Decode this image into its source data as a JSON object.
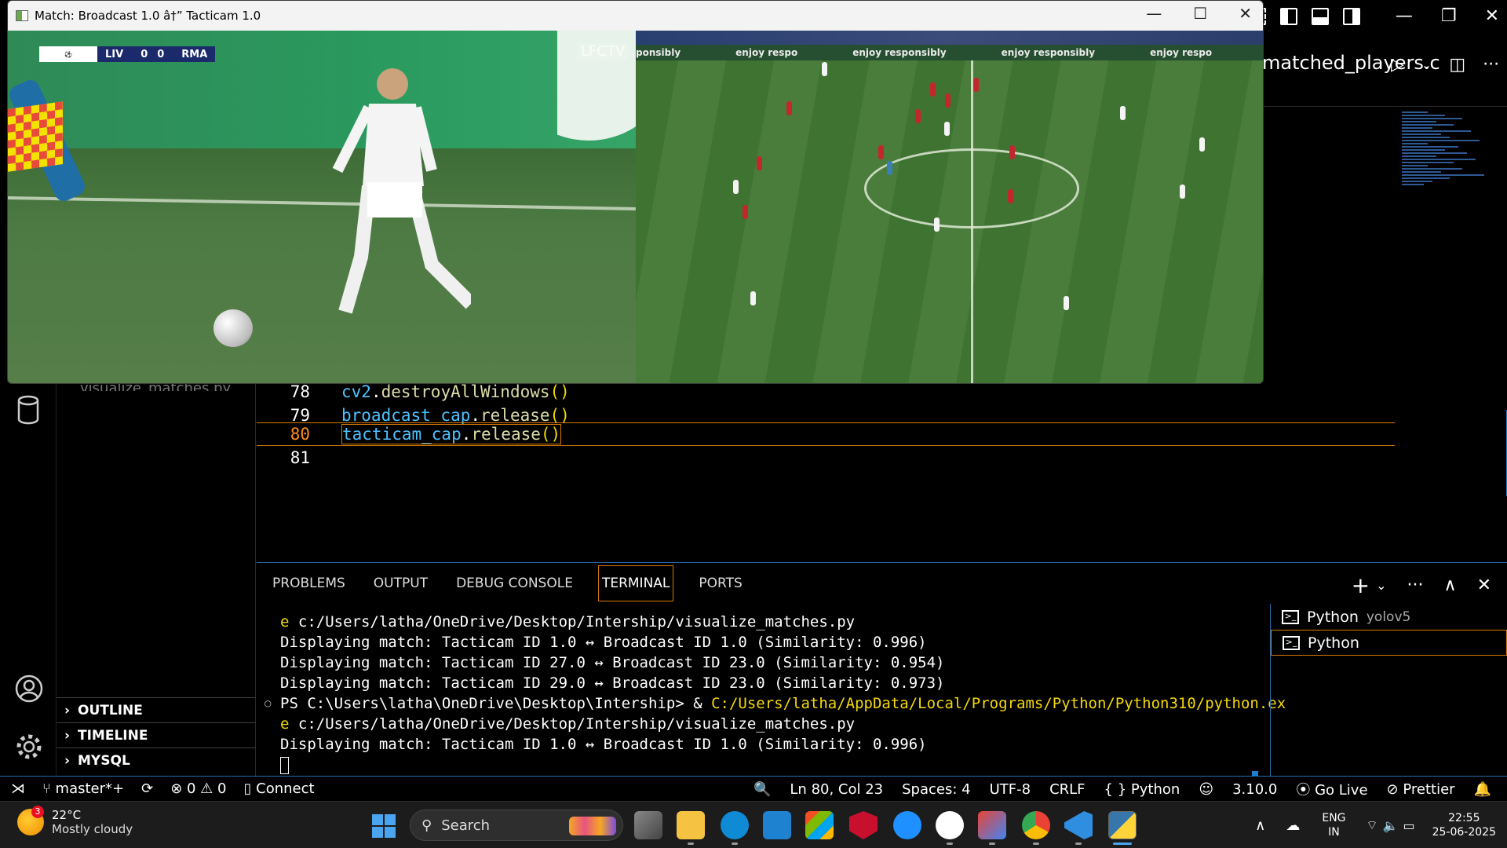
{
  "cv_window": {
    "title": "Match: Broadcast 1.0 â†” Tacticam 1.0",
    "minimize": "—",
    "maximize": "☐",
    "close": "✕",
    "broadcast": {
      "scoreboard": {
        "home": "LIV",
        "home_score": "0",
        "away_score": "0",
        "away": "RMA"
      },
      "watermark": "LFCTV"
    },
    "tacticam": {
      "ad_text": [
        "ponsibly",
        "enjoy respo",
        "enjoy responsibly",
        "enjoy responsibly",
        "enjoy respo"
      ]
    }
  },
  "vscode": {
    "tab_partial": "matched_players.c",
    "run_icon": "▷",
    "split_icon": "◫",
    "more_icon": "···",
    "explorer": {
      "partial_file": "visualize_matches.py",
      "sections": [
        {
          "chevron": "›",
          "label": "OUTLINE"
        },
        {
          "chevron": "›",
          "label": "TIMELINE"
        },
        {
          "chevron": "›",
          "label": "MYSQL"
        }
      ]
    },
    "code": [
      {
        "num": "78",
        "var": "cv2",
        "dot": ".",
        "fn": "destroyAllWindows",
        "paren": "()"
      },
      {
        "num": "79",
        "var": "broadcast_cap",
        "dot": ".",
        "fn": "release",
        "paren": "()"
      },
      {
        "num": "80",
        "var": "tacticam_cap",
        "dot": ".",
        "fn": "release",
        "paren": "()"
      },
      {
        "num": "81",
        "var": "",
        "dot": "",
        "fn": "",
        "paren": ""
      }
    ],
    "panel": {
      "tabs": [
        "PROBLEMS",
        "OUTPUT",
        "DEBUG CONSOLE",
        "TERMINAL",
        "PORTS"
      ],
      "active_tab": "TERMINAL",
      "actions": {
        "add": "+",
        "dropdown": "⌄",
        "more": "···",
        "maximize": "∧",
        "close": "✕"
      },
      "terminal_lines": [
        {
          "prefix": "e",
          "text": " c:/Users/latha/OneDrive/Desktop/Intership/visualize_matches.py"
        },
        {
          "prefix": "",
          "text": "Displaying match: Tacticam ID 1.0 ↔ Broadcast ID 1.0 (Similarity: 0.996)"
        },
        {
          "prefix": "",
          "text": "Displaying match: Tacticam ID 27.0 ↔ Broadcast ID 23.0 (Similarity: 0.954)"
        },
        {
          "prefix": "",
          "text": "Displaying match: Tacticam ID 29.0 ↔ Broadcast ID 23.0 (Similarity: 0.973)"
        },
        {
          "prefix": "PS C:\\Users\\latha\\OneDrive\\Desktop\\Intership> & ",
          "text": "C:/Users/latha/AppData/Local/Programs/Python/Python310/python.ex"
        },
        {
          "prefix": "e",
          "text": " c:/Users/latha/OneDrive/Desktop/Intership/visualize_matches.py"
        },
        {
          "prefix": "",
          "text": "Displaying match: Tacticam ID 1.0 ↔ Broadcast ID 1.0 (Similarity: 0.996)"
        }
      ],
      "terminals": [
        {
          "name": "Python",
          "sub": "yolov5"
        },
        {
          "name": "Python",
          "sub": ""
        }
      ]
    },
    "status": {
      "remote": "⋊",
      "branch": "master*+",
      "sync": "⟳",
      "errors": "0",
      "warnings": "0",
      "connect": "Connect",
      "zoom": "🔍",
      "position": "Ln 80, Col 23",
      "spaces": "Spaces: 4",
      "encoding": "UTF-8",
      "eol": "CRLF",
      "language": "Python",
      "language_icon": "{ }",
      "copilot": "☺",
      "version": "3.10.0",
      "golive": "Go Live",
      "prettier": "Prettier",
      "bell": "🔔"
    }
  },
  "taskbar": {
    "weather": {
      "badge": "3",
      "temp": "22°C",
      "condition": "Mostly cloudy"
    },
    "search_placeholder": "Search",
    "tray": {
      "lang1": "ENG",
      "lang2": "IN",
      "time": "22:55",
      "date": "25-06-2025"
    },
    "colors": {
      "edge": "#0f8bd6",
      "explorer": "#f5c242",
      "mcafee": "#c8102e",
      "vscode": "#2f8ee0",
      "chrome": "#1ea446"
    }
  }
}
